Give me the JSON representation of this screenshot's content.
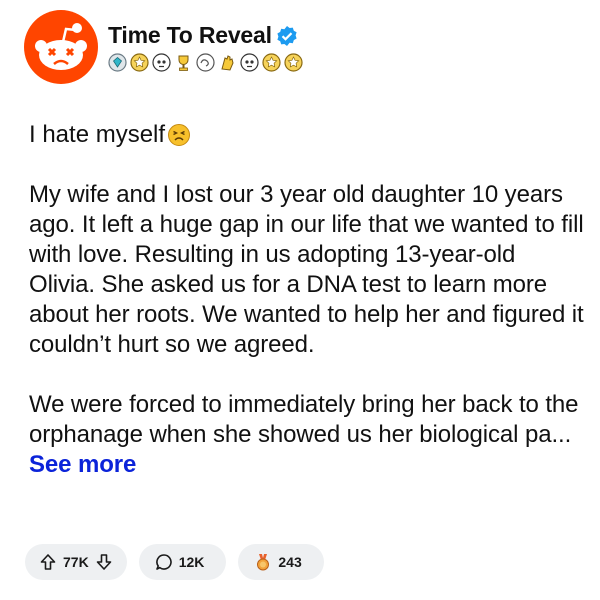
{
  "header": {
    "author": "Time To Reveal",
    "verified": true,
    "badges": [
      "diamond-badge-icon",
      "gold-trophy-icon",
      "skull-badge-icon",
      "gold-cup-icon",
      "swirl-badge-icon",
      "clap-badge-icon",
      "skull-badge-icon",
      "gold-trophy-icon",
      "gold-trophy-icon"
    ]
  },
  "post": {
    "title": "I hate myself",
    "title_emoji": "persevering-face-emoji",
    "paragraph_1": "My wife and I lost our 3 year old daughter 10 years ago. It left a huge gap in our life that we wanted to fill with love. Resulting in us adopting 13-year-old Olivia. She asked us for a DNA test to learn more about her roots. We wanted to help her and figured it couldn’t hurt so we agreed.",
    "paragraph_2": "We were forced to immediately bring her back to the orphanage when she showed us her biological pa...",
    "see_more": "See more"
  },
  "actions": {
    "upvotes": "77K",
    "comments": "12K",
    "awards": "243"
  },
  "colors": {
    "brand": "#ff4500",
    "link": "#0b23d9",
    "verified": "#1d9bf0",
    "pill_bg": "#eef0f2"
  }
}
